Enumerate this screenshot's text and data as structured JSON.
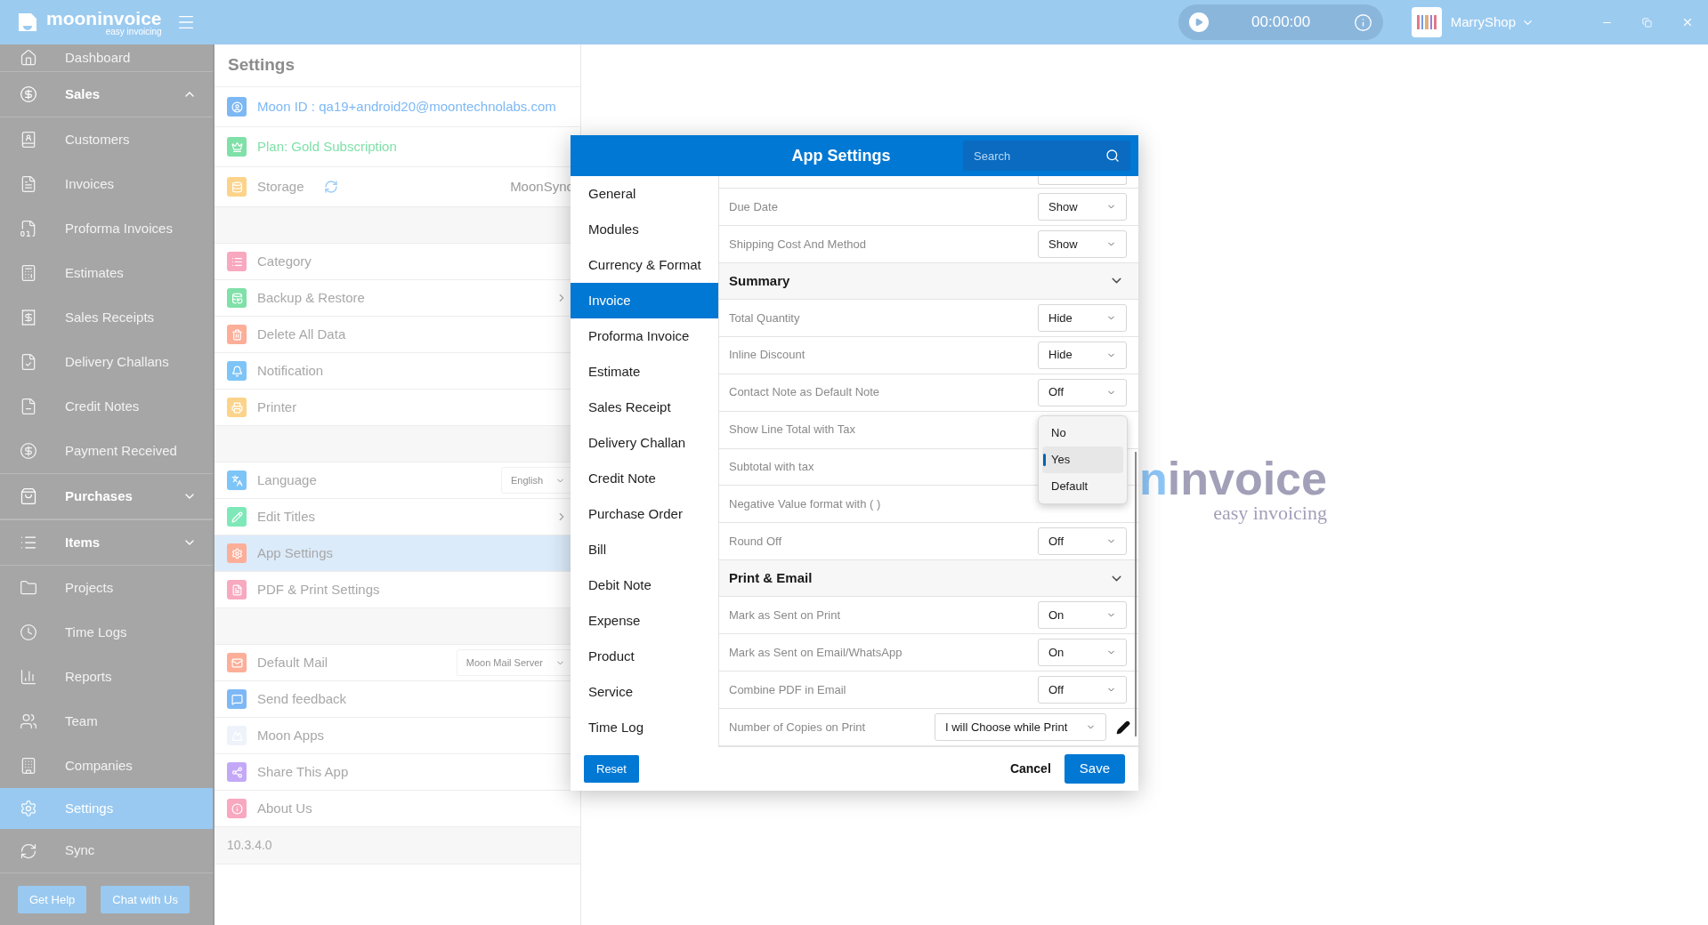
{
  "app": {
    "brand": "mooninvoice",
    "tagline": "easy invoicing"
  },
  "timer": {
    "time": "00:00:00"
  },
  "account": {
    "name": "MarryShop"
  },
  "sidebar": {
    "items": [
      {
        "kind": "item",
        "label": "Dashboard",
        "selected": false
      },
      {
        "kind": "section",
        "label": "Sales",
        "expanded": true
      },
      {
        "kind": "item",
        "label": "Customers",
        "selected": false
      },
      {
        "kind": "item",
        "label": "Invoices",
        "selected": false
      },
      {
        "kind": "item",
        "label": "Proforma Invoices",
        "selected": false
      },
      {
        "kind": "item",
        "label": "Estimates",
        "selected": false
      },
      {
        "kind": "item",
        "label": "Sales Receipts",
        "selected": false
      },
      {
        "kind": "item",
        "label": "Delivery Challans",
        "selected": false
      },
      {
        "kind": "item",
        "label": "Credit Notes",
        "selected": false
      },
      {
        "kind": "item",
        "label": "Payment Received",
        "selected": false
      },
      {
        "kind": "section",
        "label": "Purchases",
        "expanded": false
      },
      {
        "kind": "section",
        "label": "Items",
        "expanded": false
      },
      {
        "kind": "item",
        "label": "Projects",
        "selected": false
      },
      {
        "kind": "item",
        "label": "Time Logs",
        "selected": false
      },
      {
        "kind": "item",
        "label": "Reports",
        "selected": false
      },
      {
        "kind": "item",
        "label": "Team",
        "selected": false
      },
      {
        "kind": "item",
        "label": "Companies",
        "selected": false
      },
      {
        "kind": "item",
        "label": "Settings",
        "selected": true
      },
      {
        "kind": "item",
        "label": "Sync",
        "selected": false
      }
    ],
    "buttons": [
      "Get Help",
      "Chat with Us"
    ]
  },
  "settings": {
    "title": "Settings",
    "groups": [
      [
        {
          "kind": "colored",
          "label": "Moon ID : qa19+android20@moontechnolabs.com",
          "color": "#7db8f5",
          "selected": false
        },
        {
          "kind": "colored",
          "label": "Plan: Gold Subscription",
          "color": "#7fe0a8",
          "selected": false
        },
        {
          "kind": "sync",
          "label": "Storage",
          "value": "MoonSync",
          "color": "#fcd38a",
          "selected": false
        }
      ],
      [
        {
          "kind": "plain",
          "label": "Category",
          "color": "#f8a8bf",
          "selected": false
        },
        {
          "kind": "submenu",
          "label": "Backup & Restore",
          "color": "#7fe0a8",
          "selected": false
        },
        {
          "kind": "plain",
          "label": "Delete All Data",
          "color": "#fcae98",
          "selected": false
        },
        {
          "kind": "plain",
          "label": "Notification",
          "color": "#7dc4f7",
          "selected": false
        },
        {
          "kind": "plain",
          "label": "Printer",
          "color": "#fcd38a",
          "selected": false
        }
      ],
      [
        {
          "kind": "select",
          "label": "Language",
          "value": "English",
          "color": "#7dc4f7",
          "selected": false
        },
        {
          "kind": "submenu",
          "label": "Edit Titles",
          "color": "#7fe8b8",
          "selected": false
        },
        {
          "kind": "plain",
          "label": "App Settings",
          "color": "#fcae98",
          "selected": true
        },
        {
          "kind": "plain",
          "label": "PDF & Print Settings",
          "color": "#f8a8bf",
          "selected": false
        }
      ],
      [
        {
          "kind": "select",
          "label": "Default Mail",
          "value": "Moon Mail Server",
          "color": "#fcae98",
          "selected": false
        },
        {
          "kind": "plain",
          "label": "Send feedback",
          "color": "#7db8f5",
          "selected": false
        },
        {
          "kind": "plain",
          "label": "Moon Apps",
          "color": "#eef3fb",
          "selected": false
        },
        {
          "kind": "plain",
          "label": "Share This App",
          "color": "#c4a8f8",
          "selected": false
        },
        {
          "kind": "plain",
          "label": "About Us",
          "color": "#f8a8bf",
          "selected": false
        }
      ]
    ],
    "version": "10.3.4.0"
  },
  "background_logo": {
    "accent": "n",
    "name": "invoice",
    "tagline": "easy invoicing"
  },
  "dialog": {
    "title": "App Settings",
    "search": {
      "placeholder": "Search"
    },
    "nav": [
      {
        "label": "General",
        "selected": false
      },
      {
        "label": "Modules",
        "selected": false
      },
      {
        "label": "Currency & Format",
        "selected": false
      },
      {
        "label": "Invoice",
        "selected": true
      },
      {
        "label": "Proforma Invoice",
        "selected": false
      },
      {
        "label": "Estimate",
        "selected": false
      },
      {
        "label": "Sales Receipt",
        "selected": false
      },
      {
        "label": "Delivery Challan",
        "selected": false
      },
      {
        "label": "Credit Note",
        "selected": false
      },
      {
        "label": "Purchase Order",
        "selected": false
      },
      {
        "label": "Bill",
        "selected": false
      },
      {
        "label": "Debit Note",
        "selected": false
      },
      {
        "label": "Expense",
        "selected": false
      },
      {
        "label": "Product",
        "selected": false
      },
      {
        "label": "Service",
        "selected": false
      },
      {
        "label": "Time Log",
        "selected": false
      }
    ],
    "rows": [
      {
        "kind": "option",
        "label": "Due Date",
        "value": "Show"
      },
      {
        "kind": "option",
        "label": "Shipping Cost And Method",
        "value": "Show"
      },
      {
        "kind": "header",
        "label": "Summary",
        "expanded": true
      },
      {
        "kind": "option",
        "label": "Total Quantity",
        "value": "Hide"
      },
      {
        "kind": "option",
        "label": "Inline Discount",
        "value": "Hide"
      },
      {
        "kind": "option",
        "label": "Contact Note as Default Note",
        "value": "Off"
      },
      {
        "kind": "open",
        "label": "Show Line Total with Tax",
        "options": [
          {
            "label": "No",
            "selected": false
          },
          {
            "label": "Yes",
            "selected": true
          },
          {
            "label": "Default",
            "selected": false
          }
        ]
      },
      {
        "kind": "covered",
        "label": "Subtotal with tax"
      },
      {
        "kind": "covered",
        "label": "Negative Value format with ( )"
      },
      {
        "kind": "option",
        "label": "Round Off",
        "value": "Off"
      },
      {
        "kind": "header",
        "label": "Print & Email",
        "expanded": true
      },
      {
        "kind": "option",
        "label": "Mark as Sent on Print",
        "value": "On"
      },
      {
        "kind": "option",
        "label": "Mark as Sent on Email/WhatsApp",
        "value": "On"
      },
      {
        "kind": "option",
        "label": "Combine PDF in Email",
        "value": "Off"
      },
      {
        "kind": "edit",
        "label": "Number of Copies on Print",
        "value": "I will Choose while Print"
      }
    ],
    "buttons": {
      "reset": "Reset",
      "cancel": "Cancel",
      "save": "Save"
    }
  }
}
